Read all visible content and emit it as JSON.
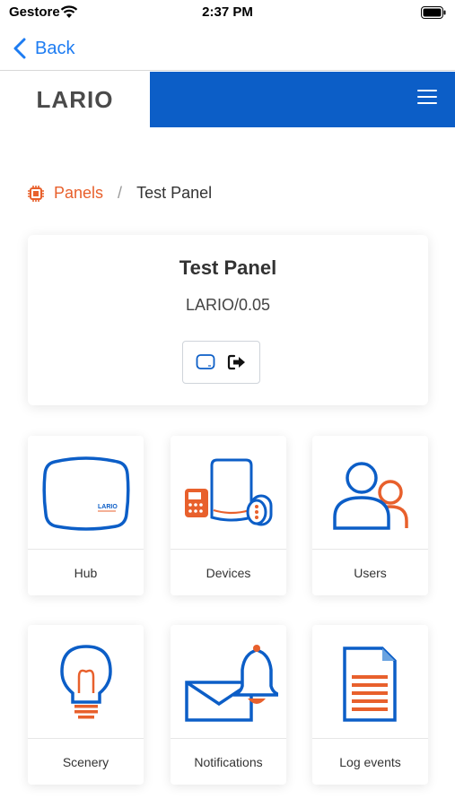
{
  "status": {
    "carrier": "Gestore",
    "time": "2:37 PM"
  },
  "nav": {
    "back_label": "Back"
  },
  "header": {
    "logo": "LARIO",
    "brand_color": "#0c5ec7"
  },
  "breadcrumb": {
    "root_label": "Panels",
    "separator": "/",
    "current_label": "Test Panel",
    "accent_color": "#e8602c"
  },
  "panel": {
    "title": "Test Panel",
    "version": "LARIO/0.05",
    "actions": [
      {
        "icon": "tablet-icon"
      },
      {
        "icon": "logout-icon"
      }
    ]
  },
  "tiles": [
    {
      "label": "Hub",
      "icon": "hub-icon"
    },
    {
      "label": "Devices",
      "icon": "devices-icon"
    },
    {
      "label": "Users",
      "icon": "users-icon"
    },
    {
      "label": "Scenery",
      "icon": "lightbulb-icon"
    },
    {
      "label": "Notifications",
      "icon": "notifications-icon"
    },
    {
      "label": "Log events",
      "icon": "document-icon"
    }
  ]
}
